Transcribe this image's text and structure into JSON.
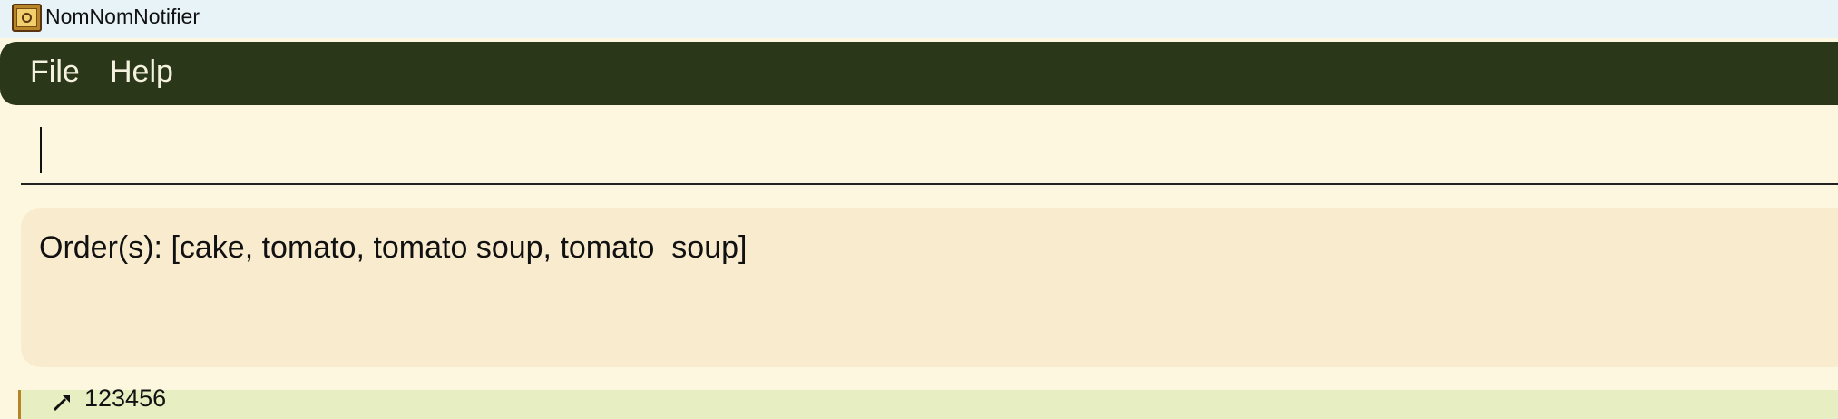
{
  "window": {
    "title": "NomNomNotifier",
    "icon": "book-icon"
  },
  "menu": {
    "items": [
      {
        "label": "File"
      },
      {
        "label": "Help"
      }
    ]
  },
  "command": {
    "value": "",
    "placeholder": ""
  },
  "result": {
    "text": "Order(s): [cake, tomato, tomato soup, tomato  soup]"
  },
  "list": {
    "visible_item": {
      "phone": "123456",
      "icon": "phone-pin-icon"
    }
  },
  "colors": {
    "menubar": "#2a3718",
    "page_background": "#fdf7df",
    "result_panel": "#f9ecce",
    "list_card": "#e7efc2",
    "card_border": "#b7842b"
  }
}
